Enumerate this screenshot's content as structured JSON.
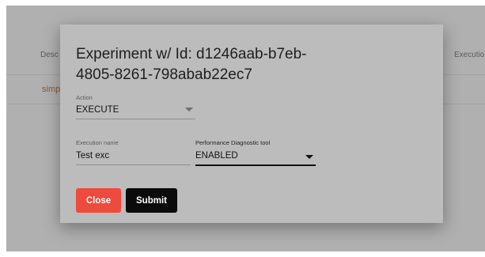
{
  "background": {
    "columns": {
      "description": "Desc",
      "execution": "Executio"
    },
    "row_link": "simp"
  },
  "dialog": {
    "title": "Experiment w/ Id: d1246aab-b7eb-4805-8261-798abab22ec7",
    "fields": {
      "action": {
        "label": "Action",
        "value": "EXECUTE"
      },
      "execution_name": {
        "label": "Execution name",
        "value": "Test exc"
      },
      "performance_tool": {
        "label": "Performance Diagnostic tool",
        "value": "ENABLED"
      }
    },
    "buttons": {
      "close": "Close",
      "submit": "Submit"
    }
  },
  "colors": {
    "overlay": "#b0b0b0",
    "dialog": "#bcbcbc",
    "close_button": "#ee4a3d",
    "submit_button": "#0b0b0b"
  },
  "icons": {
    "dropdown": "chevron-down-icon"
  }
}
